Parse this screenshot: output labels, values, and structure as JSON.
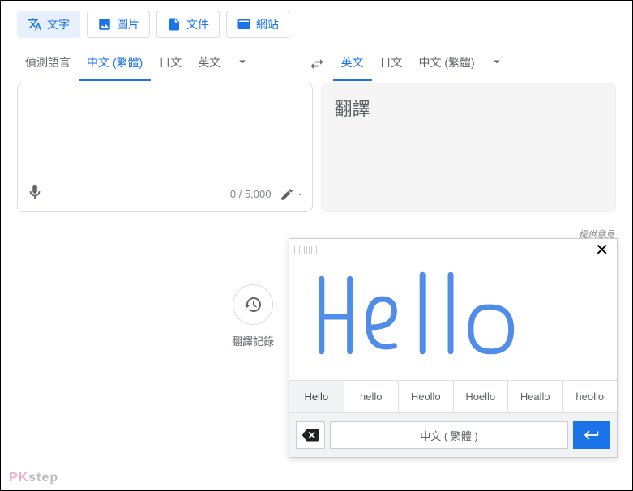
{
  "topTabs": {
    "text": "文字",
    "images": "圖片",
    "documents": "文件",
    "websites": "網站"
  },
  "sourceLangs": {
    "detect": "偵測語言",
    "zh": "中文 (繁體)",
    "ja": "日文",
    "en": "英文"
  },
  "targetLangs": {
    "en": "英文",
    "ja": "日文",
    "zh": "中文 (繁體)"
  },
  "sourcePanel": {
    "counter": "0 / 5,000"
  },
  "targetPanel": {
    "placeholder": "翻譯"
  },
  "feedback": "提供意見",
  "history": {
    "label": "翻譯記錄"
  },
  "handwriting": {
    "suggestions": [
      "Hello",
      "hello",
      "Heollo",
      "Hoello",
      "Heallo",
      "heollo"
    ],
    "langButton": "中文 ( 繁體 )"
  },
  "watermark": {
    "a": "PK",
    "b": "step"
  }
}
